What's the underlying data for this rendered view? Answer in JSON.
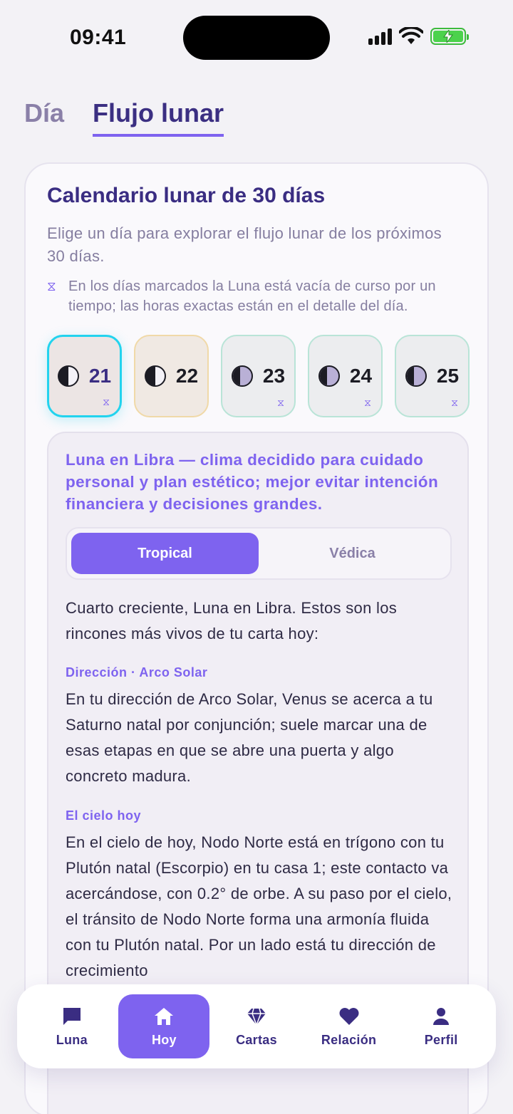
{
  "status_bar": {
    "time": "09:41"
  },
  "top_tabs": [
    {
      "label": "Día",
      "active": false
    },
    {
      "label": "Flujo lunar",
      "active": true
    }
  ],
  "calendar": {
    "title": "Calendario lunar de 30 días",
    "subtitle": "Elige un día para explorar el flujo lunar de los próximos 30 días.",
    "void_note": "En los días marcados la Luna está vacía de curso por un tiempo; las horas exactas están en el detalle del día.",
    "days": [
      {
        "num": "21",
        "phase": "first-quarter",
        "void": true,
        "selected": true
      },
      {
        "num": "22",
        "phase": "first-quarter",
        "void": false,
        "selected": false
      },
      {
        "num": "23",
        "phase": "waxing-gibbous",
        "void": true,
        "selected": false
      },
      {
        "num": "24",
        "phase": "waxing-gibbous",
        "void": true,
        "selected": false
      },
      {
        "num": "25",
        "phase": "waxing-gibbous",
        "void": true,
        "selected": false
      }
    ]
  },
  "detail": {
    "headline": "Luna en Libra — clima decidido para cuidado personal y plan estético; mejor evitar intención financiera y decisiones grandes.",
    "segment": {
      "tropical": "Tropical",
      "vedic": "Védica",
      "active": "tropical"
    },
    "intro": "Cuarto creciente, Luna en Libra. Estos son los rincones más vivos de tu carta hoy:",
    "sections": [
      {
        "label": "Dirección · Arco Solar",
        "text": "En tu dirección de Arco Solar, Venus se acerca a tu Saturno natal por conjunción; suele marcar una de esas etapas en que se abre una puerta y algo concreto madura."
      },
      {
        "label": "El cielo hoy",
        "text": "En el cielo de hoy, Nodo Norte está en trígono con tu Plutón natal (Escorpio) en tu casa 1; este contacto va acercándose, con 0.2° de orbe. A su paso por el cielo, el tránsito de Nodo Norte forma una armonía fluida con tu Plutón natal. Por un lado está tu dirección de crecimiento"
      }
    ]
  },
  "bottom_nav": [
    {
      "label": "Luna",
      "icon": "chat-icon",
      "active": false
    },
    {
      "label": "Hoy",
      "icon": "home-icon",
      "active": true
    },
    {
      "label": "Cartas",
      "icon": "diamond-icon",
      "active": false
    },
    {
      "label": "Relación",
      "icon": "heart-icon",
      "active": false
    },
    {
      "label": "Perfil",
      "icon": "user-icon",
      "active": false
    }
  ],
  "colors": {
    "accent": "#7e63ef",
    "title": "#3a2d82",
    "selected_border": "#22d3ee"
  }
}
